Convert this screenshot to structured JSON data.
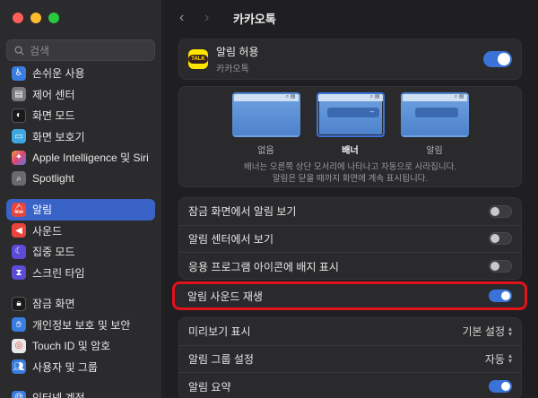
{
  "sidebar": {
    "search_placeholder": "검색",
    "items": [
      {
        "label": "손쉬운 사용",
        "icon": "accessibility-icon",
        "color": "#3a7de0"
      },
      {
        "label": "제어 센터",
        "icon": "control-center-icon",
        "color": "#7b7a80"
      },
      {
        "label": "화면 모드",
        "icon": "appearance-icon",
        "color": "#1a1a1a"
      },
      {
        "label": "화면 보호기",
        "icon": "screensaver-icon",
        "color": "#3fa7e0"
      },
      {
        "label": "Apple Intelligence 및 Siri",
        "icon": "siri-icon",
        "color": "#d8457a"
      },
      {
        "label": "Spotlight",
        "icon": "spotlight-icon",
        "color": "#6b6a70"
      },
      {
        "label": "알림",
        "icon": "bell-icon",
        "color": "#e8453c"
      },
      {
        "label": "사운드",
        "icon": "speaker-icon",
        "color": "#e8453c"
      },
      {
        "label": "집중 모드",
        "icon": "moon-icon",
        "color": "#5b4bd6"
      },
      {
        "label": "스크린 타임",
        "icon": "hourglass-icon",
        "color": "#5b4bd6"
      },
      {
        "label": "잠금 화면",
        "icon": "lock-icon",
        "color": "#1a1a1a"
      },
      {
        "label": "개인정보 보호 및 보안",
        "icon": "hand-icon",
        "color": "#3a7de0"
      },
      {
        "label": "Touch ID 및 암호",
        "icon": "fingerprint-icon",
        "color": "#e8e8e8"
      },
      {
        "label": "사용자 및 그룹",
        "icon": "users-icon",
        "color": "#3a7de0"
      },
      {
        "label": "인터넷 계정",
        "icon": "at-icon",
        "color": "#3a7de0"
      }
    ]
  },
  "header": {
    "title": "카카오톡"
  },
  "app": {
    "name": "알림 허용",
    "subtitle": "카카오톡",
    "allow": true
  },
  "styles": {
    "options": [
      {
        "label": "없음"
      },
      {
        "label": "배너"
      },
      {
        "label": "알림"
      }
    ],
    "selected": "배너",
    "description_line1": "배너는 오른쪽 상단 모서리에 나타나고 자동으로 사라집니다.",
    "description_line2": "알림은 닫을 때까지 화면에 계속 표시됩니다."
  },
  "settings": {
    "lock_screen": {
      "label": "잠금 화면에서 알림 보기",
      "on": false
    },
    "notification_center": {
      "label": "알림 센터에서 보기",
      "on": false
    },
    "badge": {
      "label": "응용 프로그램 아이콘에 배지 표시",
      "on": false
    },
    "sound": {
      "label": "알림 사운드 재생",
      "on": true
    },
    "show_previews": {
      "label": "미리보기 표시",
      "value": "기본 설정"
    },
    "grouping": {
      "label": "알림 그룹 설정",
      "value": "자동"
    },
    "summary": {
      "label": "알림 요약",
      "on": true
    }
  },
  "colors": {
    "accent": "#3a72d8",
    "highlight_box": "#e0121b",
    "kakao_yellow": "#fee500"
  }
}
